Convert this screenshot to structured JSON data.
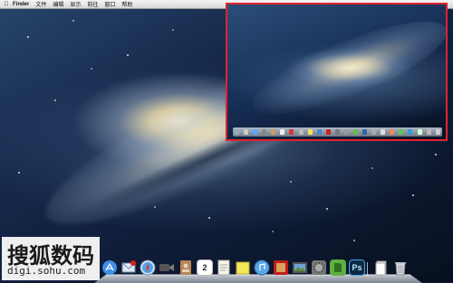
{
  "menubar": {
    "apple_icon": "apple-logo",
    "items": [
      "Finder",
      "文件",
      "编辑",
      "显示",
      "前往",
      "窗口",
      "帮助"
    ]
  },
  "watermark": {
    "title": "搜狐数码",
    "url": "digi.sohu.com"
  },
  "colors": {
    "inset_border": "#e0232f",
    "desktop_top": "#27456b",
    "desktop_bottom": "#07101f"
  },
  "dock": {
    "items": [
      {
        "name": "app-store-icon"
      },
      {
        "name": "mail-icon"
      },
      {
        "name": "safari-icon"
      },
      {
        "name": "facetime-icon"
      },
      {
        "name": "contacts-icon"
      },
      {
        "name": "calendar-icon",
        "label": "2"
      },
      {
        "name": "notes-icon"
      },
      {
        "name": "stickies-icon"
      },
      {
        "name": "itunes-icon"
      },
      {
        "name": "photo-booth-icon"
      },
      {
        "name": "iphoto-icon"
      },
      {
        "name": "system-preferences-icon"
      },
      {
        "name": "evernote-icon"
      },
      {
        "name": "photoshop-icon",
        "label": "Ps"
      },
      {
        "name": "documents-icon"
      },
      {
        "name": "trash-icon"
      }
    ]
  }
}
